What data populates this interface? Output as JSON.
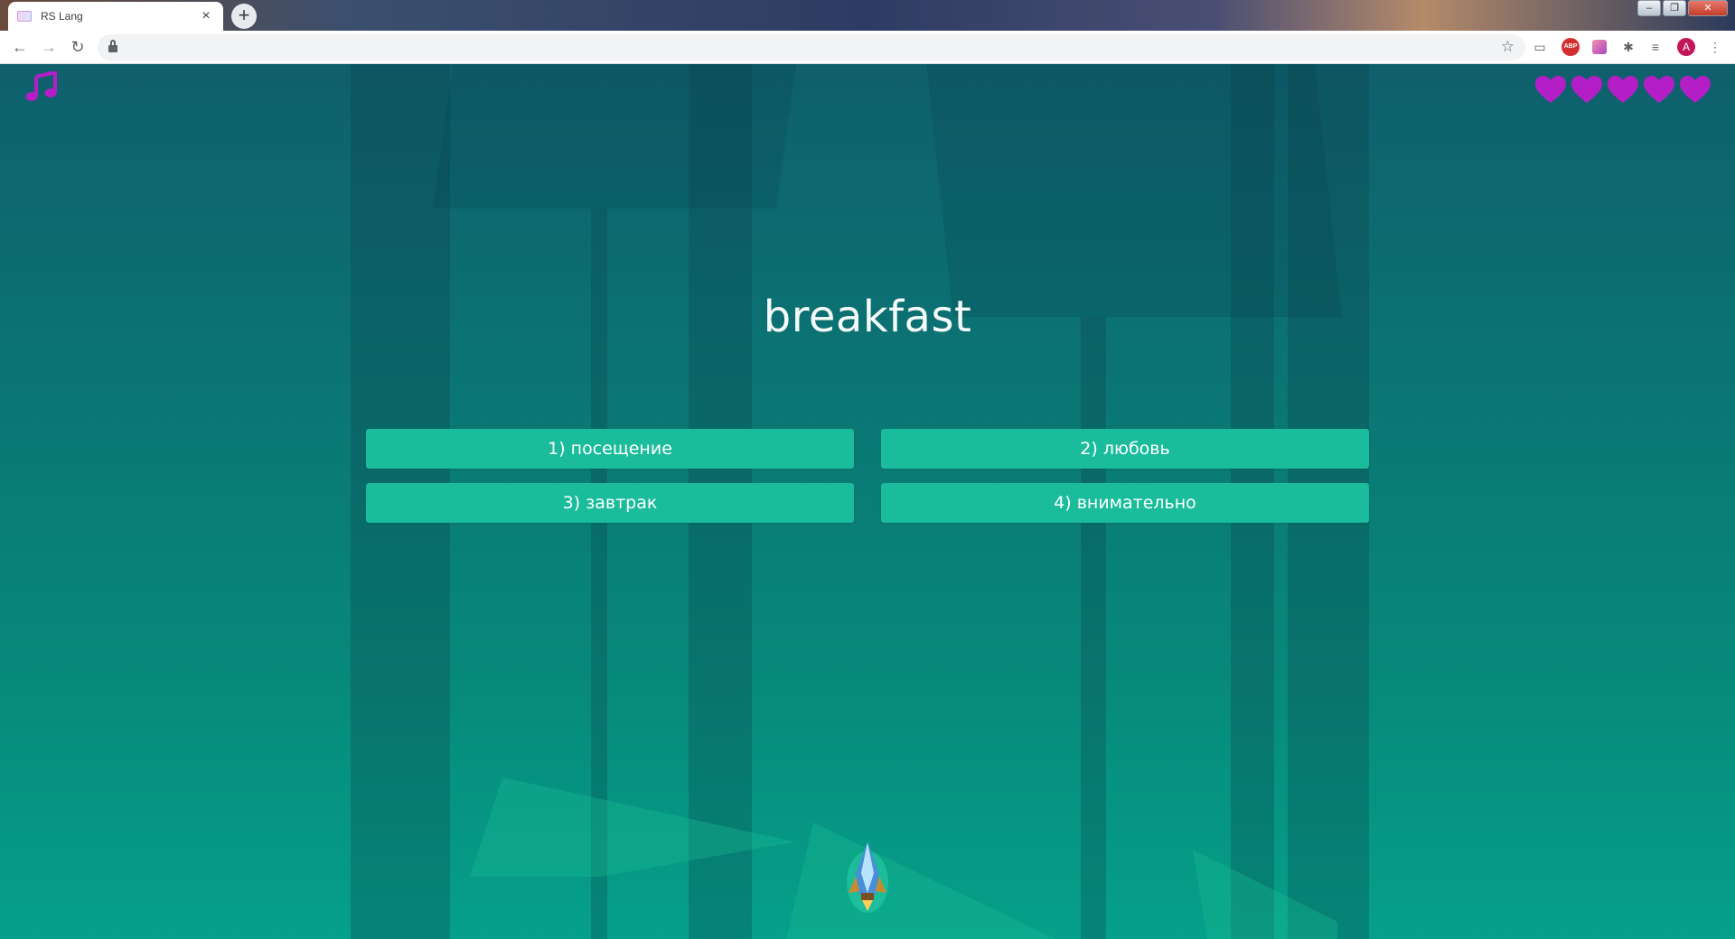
{
  "browser": {
    "tab_title": "RS Lang",
    "tab_close": "×",
    "new_tab": "+",
    "window_buttons": [
      "–",
      "❐",
      "✕"
    ],
    "nav": {
      "back": "←",
      "forward": "→",
      "reload": "↻"
    },
    "bookmark_star": "☆",
    "extensions": {
      "abp": "ABP",
      "puzzle": "✱",
      "menu": "⋮",
      "profile_initial": "A"
    }
  },
  "game": {
    "music_icon": "music-note-icon",
    "lives_total": 5,
    "lives_remaining": 5,
    "heart_color": "#b41ec7",
    "accent": "#1abc9c",
    "word": "breakfast",
    "answers": [
      "1) посещение",
      "2) любовь",
      "3) завтрак",
      "4) внимательно"
    ]
  }
}
